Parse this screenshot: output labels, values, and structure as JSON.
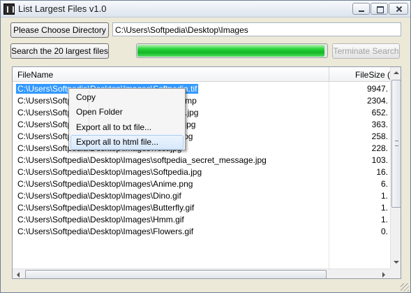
{
  "window": {
    "title": "List Largest Files v1.0"
  },
  "toolbar": {
    "choose_directory_label": "Please Choose Directory",
    "directory_path": "C:\\Users\\Softpedia\\Desktop\\Images",
    "search_label": "Search the 20 largest files",
    "terminate_label": "Terminate Search",
    "progress_fraction": 0.99
  },
  "file_list": {
    "columns": {
      "name": "FileName",
      "size": "FileSize (K"
    },
    "rows": [
      {
        "name": "C:\\Users\\Softpedia\\Desktop\\Images\\Softpedia.tif",
        "size": "9947.",
        "selected": true
      },
      {
        "name": "C:\\Users\\Softpedia\\Desktop\\Images\\bitmap.bmp",
        "size": "2304."
      },
      {
        "name": "C:\\Users\\Softpedia\\Desktop\\Images\\Rainbow.jpg",
        "size": "652."
      },
      {
        "name": "C:\\Users\\Softpedia\\Desktop\\Images\\Flowers.jpg",
        "size": "363."
      },
      {
        "name": "C:\\Users\\Softpedia\\Desktop\\Images\\Nested.jpg",
        "size": "258."
      },
      {
        "name": "C:\\Users\\Softpedia\\Desktop\\Images\\Test.jpg",
        "size": "228."
      },
      {
        "name": "C:\\Users\\Softpedia\\Desktop\\Images\\softpedia_secret_message.jpg",
        "size": "103."
      },
      {
        "name": "C:\\Users\\Softpedia\\Desktop\\Images\\Softpedia.jpg",
        "size": "16."
      },
      {
        "name": "C:\\Users\\Softpedia\\Desktop\\Images\\Anime.png",
        "size": "6."
      },
      {
        "name": "C:\\Users\\Softpedia\\Desktop\\Images\\Dino.gif",
        "size": "1."
      },
      {
        "name": "C:\\Users\\Softpedia\\Desktop\\Images\\Butterfly.gif",
        "size": "1."
      },
      {
        "name": "C:\\Users\\Softpedia\\Desktop\\Images\\Hmm.gif",
        "size": "1."
      },
      {
        "name": "C:\\Users\\Softpedia\\Desktop\\Images\\Flowers.gif",
        "size": "0."
      }
    ]
  },
  "context_menu": {
    "items": [
      {
        "label": "Copy"
      },
      {
        "label": "Open Folder"
      },
      {
        "label": "Export all to txt file..."
      },
      {
        "label": "Export all to html file...",
        "highlighted": true
      }
    ]
  },
  "colors": {
    "selection": "#3399ff",
    "progress": "#13b525"
  }
}
